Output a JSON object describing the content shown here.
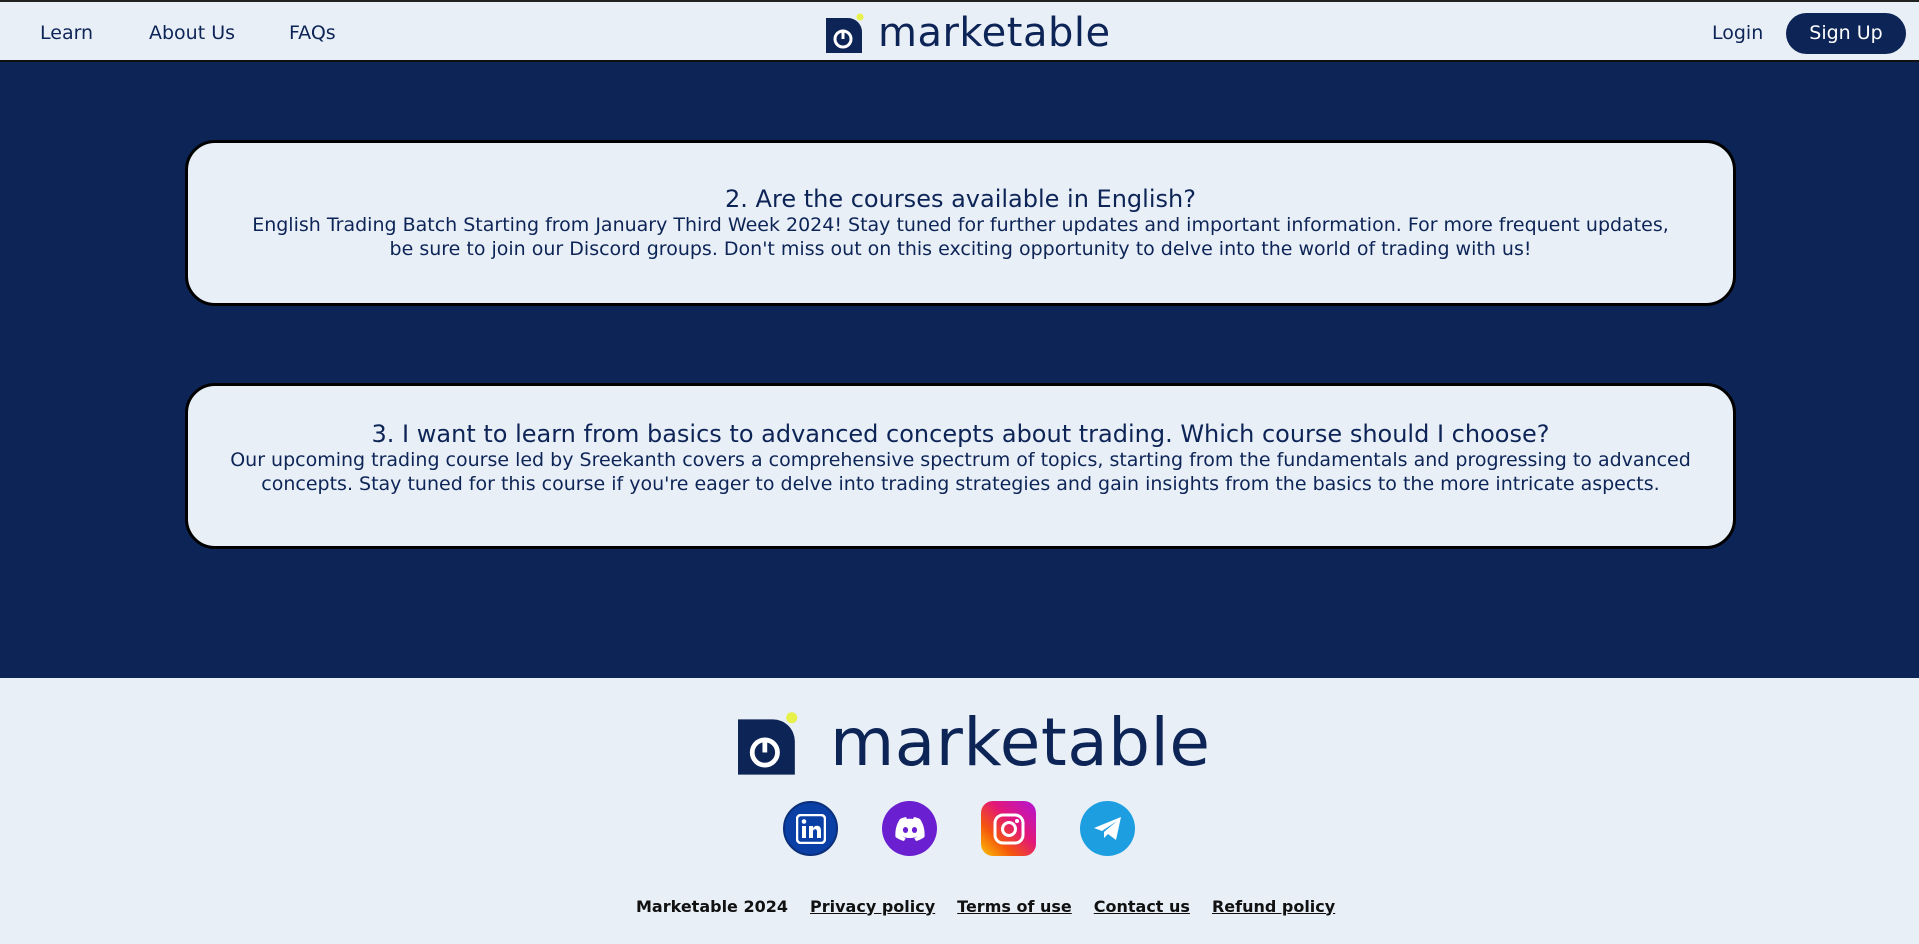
{
  "header": {
    "nav": [
      "Learn",
      "About Us",
      "FAQs"
    ],
    "brand": "marketable",
    "login_label": "Login",
    "signup_label": "Sign Up"
  },
  "faqs": [
    {
      "question": "2. Are the courses available in English?",
      "answer": "English Trading Batch Starting from January Third Week 2024! Stay tuned for  further updates and important information. For more frequent updates, be sure to join our Discord groups. Don't miss out on this exciting  opportunity to delve into the world of trading with us!"
    },
    {
      "question": "3. I want to learn from basics to advanced concepts about trading. Which course should I choose?",
      "answer": "Our upcoming trading course led by Sreekanth covers a comprehensive  spectrum of topics, starting from the fundamentals and progressing to advanced concepts. Stay tuned for this course if you're eager to delve  into trading strategies and gain insights from the basics to the more  intricate aspects."
    }
  ],
  "footer": {
    "brand": "marketable",
    "social": [
      {
        "name": "linkedin-icon",
        "color": "#0a3fa6"
      },
      {
        "name": "discord-icon",
        "color": "#6a1fd0"
      },
      {
        "name": "instagram-icon",
        "color": "#e2177a"
      },
      {
        "name": "telegram-icon",
        "color": "#1d9ee0"
      }
    ],
    "copyright": "Marketable  2024",
    "links": [
      "Privacy policy",
      "Terms of use",
      "Contact us",
      "Refund policy"
    ]
  },
  "colors": {
    "navy": "#0d2456",
    "light_bg": "#e8eff7",
    "accent_dot": "#e8f04a"
  }
}
